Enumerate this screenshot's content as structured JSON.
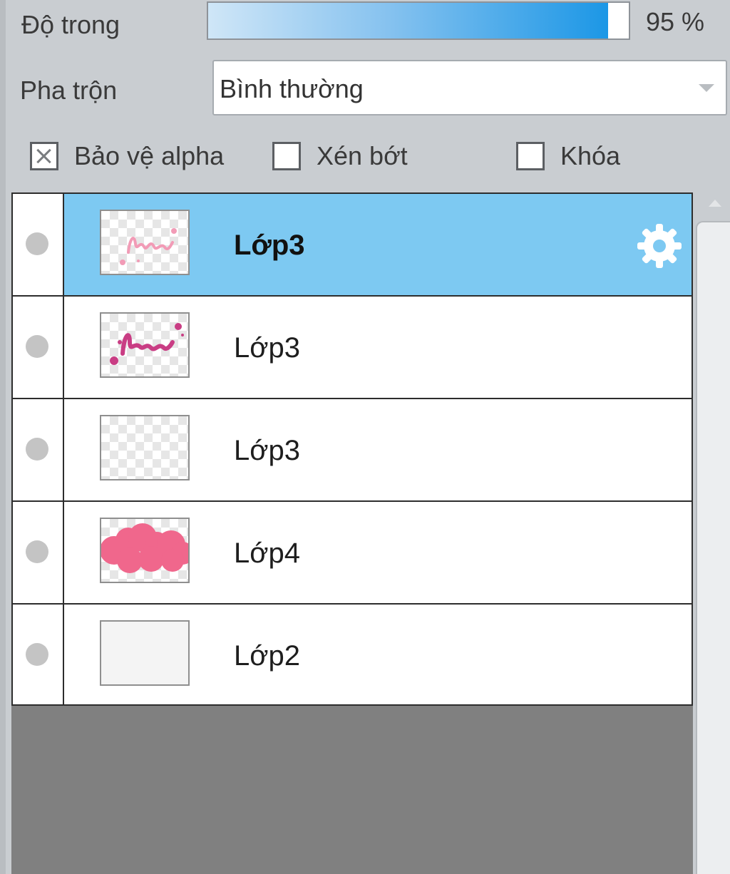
{
  "opacity": {
    "label": "Độ trong",
    "value_text": "95 %",
    "value": 95
  },
  "blend": {
    "label": "Pha trộn",
    "selected": "Bình thường"
  },
  "options": {
    "protect_alpha": {
      "label": "Bảo vệ alpha",
      "checked": true
    },
    "clip": {
      "label": "Xén bớt",
      "checked": false
    },
    "lock": {
      "label": "Khóa",
      "checked": false
    }
  },
  "layers": [
    {
      "name": "Lớp3",
      "selected": true,
      "thumbnail": "pink-script-text"
    },
    {
      "name": "Lớp3",
      "selected": false,
      "thumbnail": "magenta-script-text"
    },
    {
      "name": "Lớp3",
      "selected": false,
      "thumbnail": "empty-transparent"
    },
    {
      "name": "Lớp4",
      "selected": false,
      "thumbnail": "pink-cloud"
    },
    {
      "name": "Lớp2",
      "selected": false,
      "thumbnail": "white-fill"
    }
  ],
  "colors": {
    "selected_row": "#7dc9f2",
    "slider_accent": "#1c97e6",
    "pink": "#f0678c",
    "magenta": "#c93d84"
  }
}
